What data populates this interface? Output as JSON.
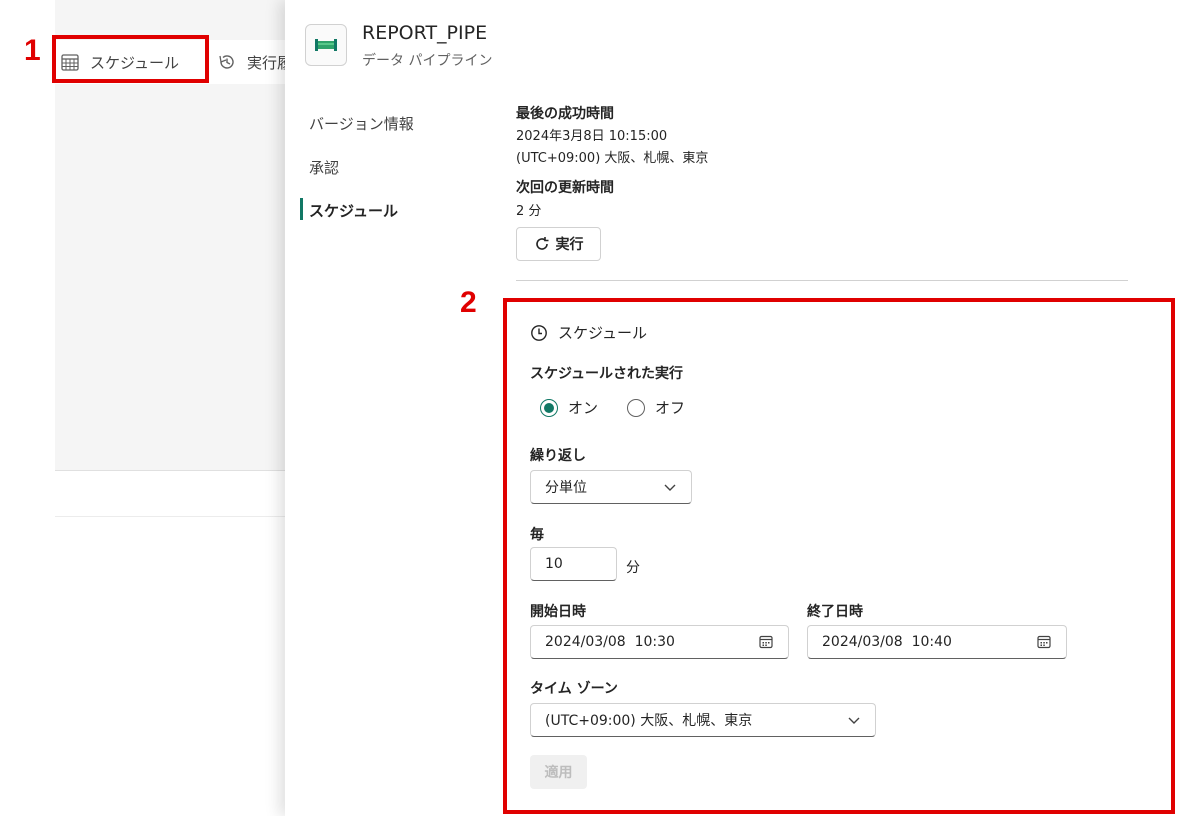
{
  "background_toolbar": {
    "schedule_label": "スケジュール",
    "history_label": "実行履"
  },
  "markers": {
    "one": "1",
    "two": "2"
  },
  "panel": {
    "title": "REPORT_PIPE",
    "subtitle": "データ パイプライン",
    "nav": [
      "バージョン情報",
      "承認",
      "スケジュール"
    ]
  },
  "status": {
    "last_success_label": "最後の成功時間",
    "last_success_value": "2024年3月8日 10:15:00",
    "last_success_tz": "(UTC+09:00) 大阪、札幌、東京",
    "next_refresh_label": "次回の更新時間",
    "next_refresh_value": "2 分",
    "run_button": "実行"
  },
  "schedule": {
    "header": "スケジュール",
    "scheduled_run_label": "スケジュールされた実行",
    "on_label": "オン",
    "off_label": "オフ",
    "selected": "オン",
    "repeat_label": "繰り返し",
    "repeat_value": "分単位",
    "every_label": "毎",
    "every_value": "10",
    "every_unit": "分",
    "start_label": "開始日時",
    "start_value": "2024/03/08  10:30",
    "end_label": "終了日時",
    "end_value": "2024/03/08  10:40",
    "timezone_label": "タイム ゾーン",
    "timezone_value": "(UTC+09:00) 大阪、札幌、東京",
    "apply_button": "適用"
  },
  "colors": {
    "accent": "#117865",
    "highlight": "#e00000"
  }
}
